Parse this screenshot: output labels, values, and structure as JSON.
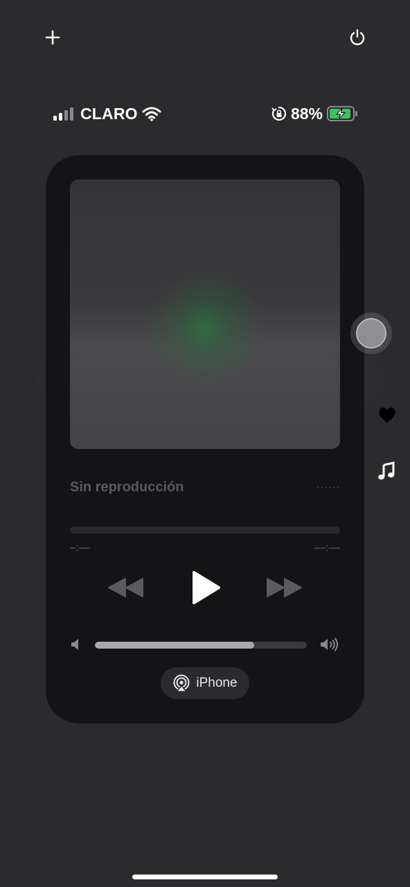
{
  "top_controls": {
    "add_icon": "plus-icon",
    "power_icon": "power-icon"
  },
  "status_bar": {
    "carrier": "CLARO",
    "battery_percent": "88%",
    "signal_bars": 2,
    "charging": true,
    "icons": [
      "signal-icon",
      "wifi-icon",
      "orientation-lock-icon",
      "battery-charging-icon"
    ],
    "battery_color": "#34c759"
  },
  "player": {
    "track_title": "Sin reproducción",
    "more_dots": "······",
    "elapsed_time": "–:––",
    "remaining_time": "––:––",
    "playback_progress": 0,
    "volume_level": 0.75,
    "output_device": "iPhone",
    "controls": [
      "rewind-icon",
      "play-icon",
      "fast-forward-icon"
    ]
  },
  "side_controls": [
    "heart-icon",
    "music-note-icon"
  ]
}
